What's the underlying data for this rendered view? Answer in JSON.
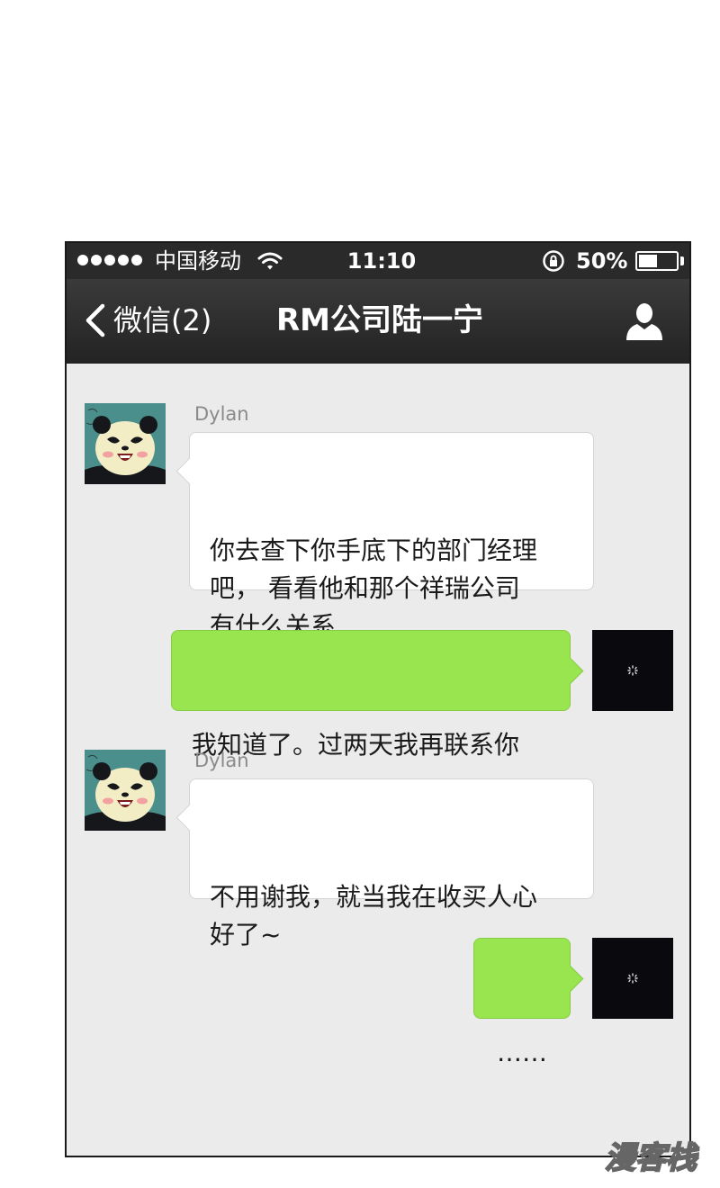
{
  "status_bar": {
    "carrier": "中国移动",
    "time": "11:10",
    "battery_text": "50%",
    "battery_level": 0.5,
    "signal_dots": 5
  },
  "nav": {
    "back_label": "微信(2)",
    "title": "RM公司陆一宁",
    "back_icon": "chevron-left-icon",
    "profile_icon": "person-icon"
  },
  "messages": [
    {
      "direction": "received",
      "sender": "Dylan",
      "text": "你去查下你手底下的部门经理\n吧， 看看他和那个祥瑞公司\n有什么关系"
    },
    {
      "direction": "sent",
      "text": "我知道了。过两天我再联系你"
    },
    {
      "direction": "received",
      "sender": "Dylan",
      "text": "不用谢我，就当我在收买人心\n好了~"
    },
    {
      "direction": "sent",
      "text": "……"
    }
  ],
  "colors": {
    "sent_bubble": "#99e550",
    "received_bubble": "#ffffff",
    "chat_background": "#ebebeb",
    "navbar": "#2a2a2a"
  },
  "watermark": "漫客栈"
}
